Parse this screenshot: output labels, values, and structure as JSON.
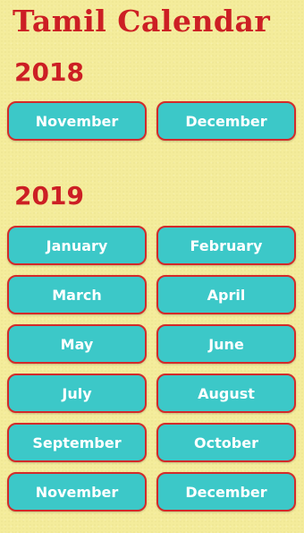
{
  "app": {
    "title": "Tamil Calendar"
  },
  "colors": {
    "background": "#f4ec9b",
    "title_red": "#cc1f24",
    "button_fill": "#3cc8c8",
    "button_border": "#d32a2a",
    "button_text": "#ffffff"
  },
  "years": [
    {
      "year": "2018",
      "months": [
        "November",
        "December"
      ]
    },
    {
      "year": "2019",
      "months": [
        "January",
        "February",
        "March",
        "April",
        "May",
        "June",
        "July",
        "August",
        "September",
        "October",
        "November",
        "December"
      ]
    }
  ]
}
